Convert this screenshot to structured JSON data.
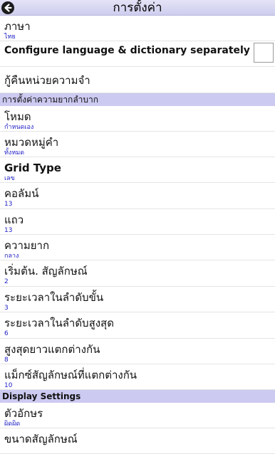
{
  "header": {
    "title": "การตั้งค่า",
    "back_icon": "back-arrow-icon"
  },
  "settings": {
    "language": {
      "label": "ภาษา",
      "value": "ไทย"
    },
    "configure_separately": {
      "label": "Configure language & dictionary separately",
      "checked": false
    },
    "restore_memory": {
      "label": "กู้คืนหน่วยความจำ"
    }
  },
  "difficulty_section": {
    "title": "การตั้งค่าความยากลำบาก",
    "items": [
      {
        "label": "โหมด",
        "value": "กำหนดเอง"
      },
      {
        "label": "หมวดหมู่คำ",
        "value": "ทั้งหมด"
      },
      {
        "label": "Grid Type",
        "value": "เลข"
      },
      {
        "label": "คอลัมน์",
        "value": "13"
      },
      {
        "label": "แถว",
        "value": "13"
      },
      {
        "label": "ความยาก",
        "value": "กลาง"
      },
      {
        "label": "เริ่มต้น. สัญลักษณ์",
        "value": "2"
      },
      {
        "label": "ระยะเวลาในลำดับขั้น",
        "value": "3"
      },
      {
        "label": "ระยะเวลาในลำดับสูงสุด",
        "value": "6"
      },
      {
        "label": "สูงสุดยาวแตกต่างกัน",
        "value": "8"
      },
      {
        "label": "แม็กซ์สัญลักษณ์ที่แตกต่างกัน",
        "value": "10"
      }
    ]
  },
  "display_section": {
    "title": "Display Settings",
    "items": [
      {
        "label": "ตัวอักษร",
        "value": "ผิดผิด"
      },
      {
        "label": "ขนาดสัญลักษณ์",
        "value": ""
      }
    ]
  },
  "colors": {
    "header_bg": "#d6d4f0",
    "section_bg": "#cccaf1",
    "value_text": "#2323c8"
  }
}
